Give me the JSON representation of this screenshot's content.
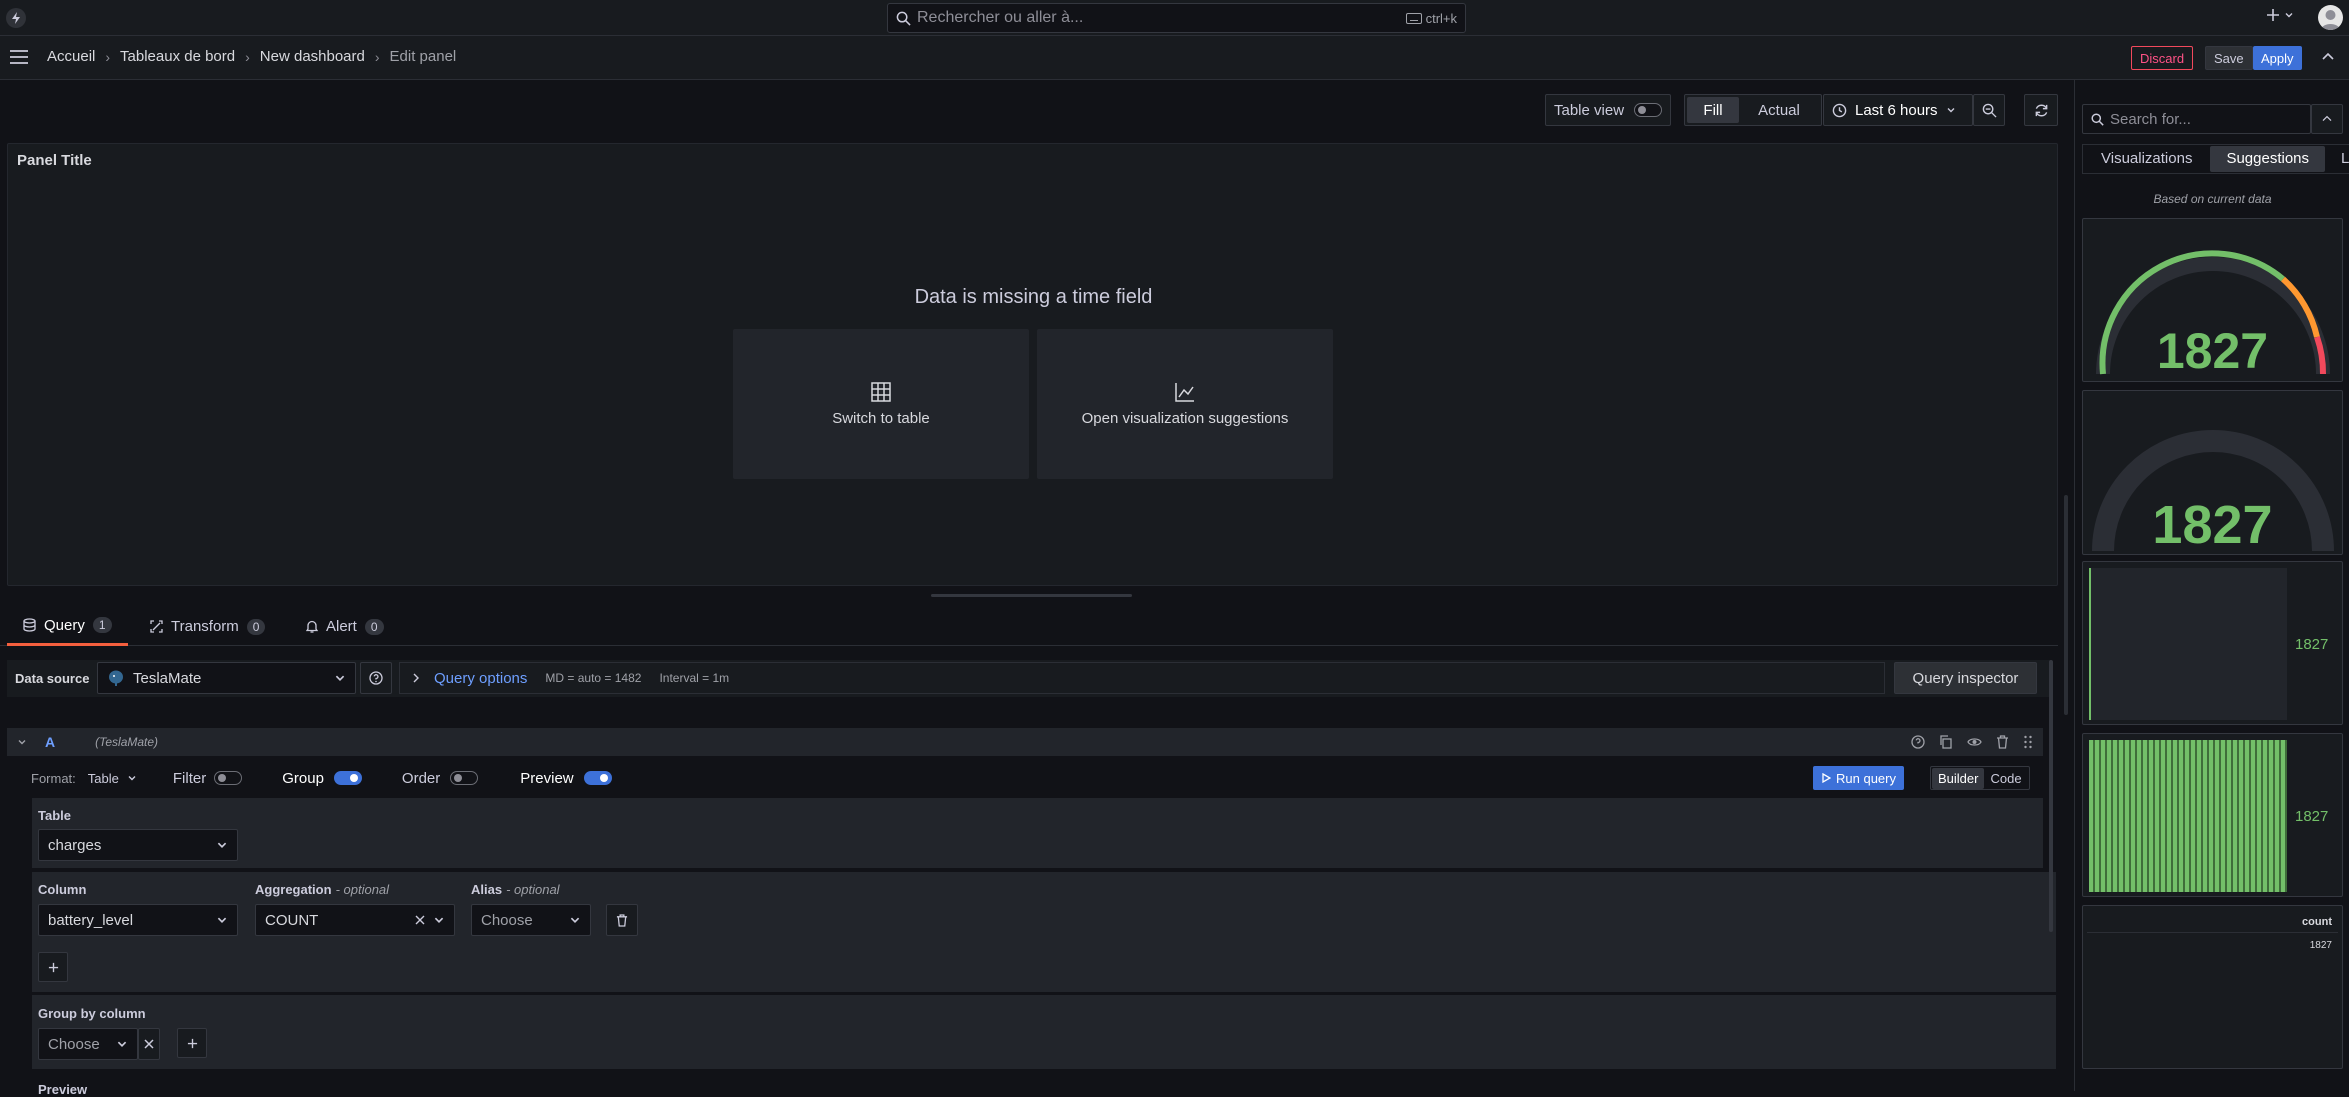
{
  "topbar": {
    "search_placeholder": "Rechercher ou aller à...",
    "shortcut": "ctrl+k"
  },
  "breadcrumb": [
    "Accueil",
    "Tableaux de bord",
    "New dashboard",
    "Edit panel"
  ],
  "actions": {
    "discard": "Discard",
    "save": "Save",
    "apply": "Apply"
  },
  "panel_toolbar": {
    "table_view": "Table view",
    "fill": "Fill",
    "actual": "Actual",
    "time_range": "Last 6 hours"
  },
  "panel": {
    "title": "Panel Title",
    "message": "Data is missing a time field",
    "switch_table": "Switch to table",
    "open_suggestions": "Open visualization suggestions"
  },
  "tabs": [
    {
      "label": "Query",
      "count": "1"
    },
    {
      "label": "Transform",
      "count": "0"
    },
    {
      "label": "Alert",
      "count": "0"
    }
  ],
  "datasource": {
    "label": "Data source",
    "value": "TeslaMate",
    "query_options": "Query options",
    "md": "MD = auto = 1482",
    "interval": "Interval = 1m",
    "inspector": "Query inspector"
  },
  "query": {
    "ref": "A",
    "ds": "(TeslaMate)",
    "format_label": "Format:",
    "format_value": "Table",
    "filter": "Filter",
    "group": "Group",
    "order": "Order",
    "preview": "Preview",
    "run": "Run query",
    "builder": "Builder",
    "code": "Code",
    "table_label": "Table",
    "table_value": "charges",
    "column_label": "Column",
    "column_value": "battery_level",
    "aggregation_label": "Aggregation",
    "aggregation_opt": "- optional",
    "aggregation_value": "COUNT",
    "alias_label": "Alias",
    "alias_opt": "- optional",
    "alias_value": "Choose",
    "group_by_label": "Group by column",
    "group_by_value": "Choose",
    "preview_label": "Preview"
  },
  "sidebar": {
    "search_placeholder": "Search for...",
    "tab_visualizations": "Visualizations",
    "tab_suggestions": "Suggestions",
    "tab_cut": "L",
    "note": "Based on current data",
    "value": "1827",
    "table_header": "count"
  },
  "colors": {
    "accent": "#3d71d9",
    "green": "#73bf69",
    "discard": "#f2495c",
    "tab_underline": "#f55f3e"
  }
}
